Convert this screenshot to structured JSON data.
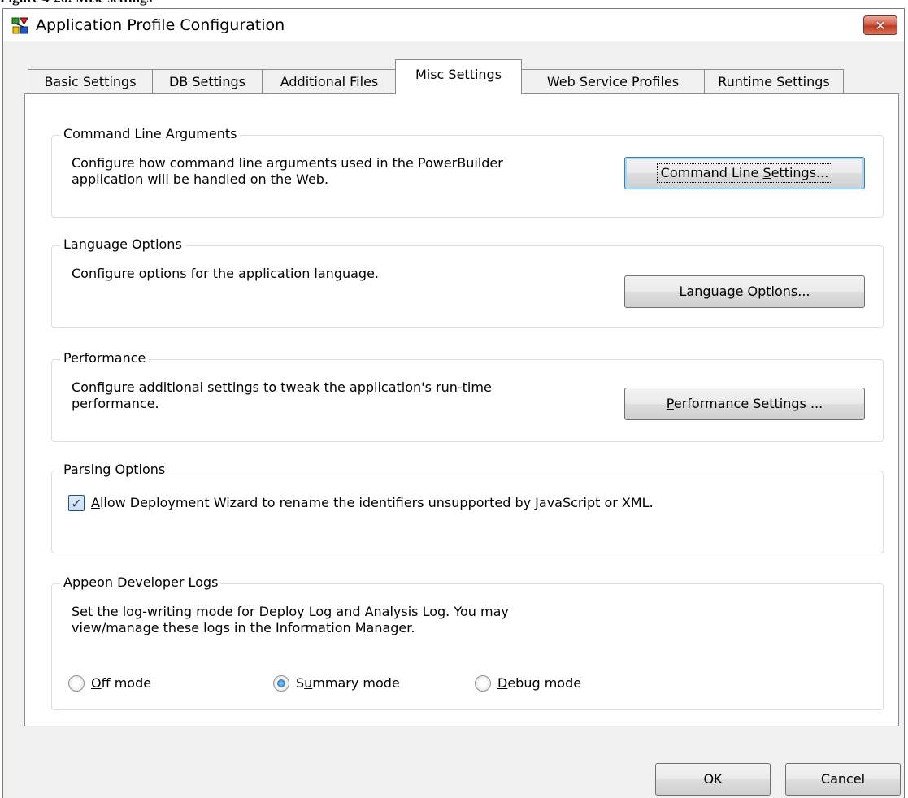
{
  "caption": "Figure 4-26: Misc settings",
  "window": {
    "title": "Application Profile Configuration",
    "app_icon": "appeon-app-icon",
    "close_icon": "close-icon"
  },
  "tabs": [
    {
      "label": "Basic Settings",
      "active": false
    },
    {
      "label": "DB Settings",
      "active": false
    },
    {
      "label": "Additional Files",
      "active": false
    },
    {
      "label": "Misc Settings",
      "active": true
    },
    {
      "label": "Web Service Profiles",
      "active": false
    },
    {
      "label": "Runtime Settings",
      "active": false
    }
  ],
  "groups": {
    "command_line": {
      "title": "Command Line Arguments",
      "description": "Configure how command line arguments used in the PowerBuilder\napplication will be handled on the Web.",
      "button": {
        "before": "Command Line ",
        "mnemonic": "S",
        "after": "ettings..."
      }
    },
    "language": {
      "title": "Language Options",
      "description": "Configure options for the application language.",
      "button": {
        "before": "",
        "mnemonic": "L",
        "after": "anguage Options..."
      }
    },
    "performance": {
      "title": "Performance",
      "description": "Configure additional settings to tweak the application's run-time\nperformance.",
      "button": {
        "before": "",
        "mnemonic": "P",
        "after": "erformance Settings ..."
      }
    },
    "parsing": {
      "title": "Parsing Options",
      "checkbox": {
        "checked": true,
        "mnemonic": "A",
        "label_rest": "llow Deployment Wizard to rename the identifiers unsupported by JavaScript or XML."
      }
    },
    "logs": {
      "title": "Appeon Developer Logs",
      "description": "Set the log-writing mode for Deploy Log and Analysis Log.  You may\nview/manage these logs in the Information Manager.",
      "modes": [
        {
          "before": "",
          "mnemonic": "O",
          "after": "ff mode",
          "checked": false
        },
        {
          "before": "S",
          "mnemonic": "u",
          "after": "mmary mode",
          "checked": true
        },
        {
          "before": "",
          "mnemonic": "D",
          "after": "ebug mode",
          "checked": false
        }
      ]
    }
  },
  "footer": {
    "ok_label": "OK",
    "cancel_label": "Cancel"
  }
}
